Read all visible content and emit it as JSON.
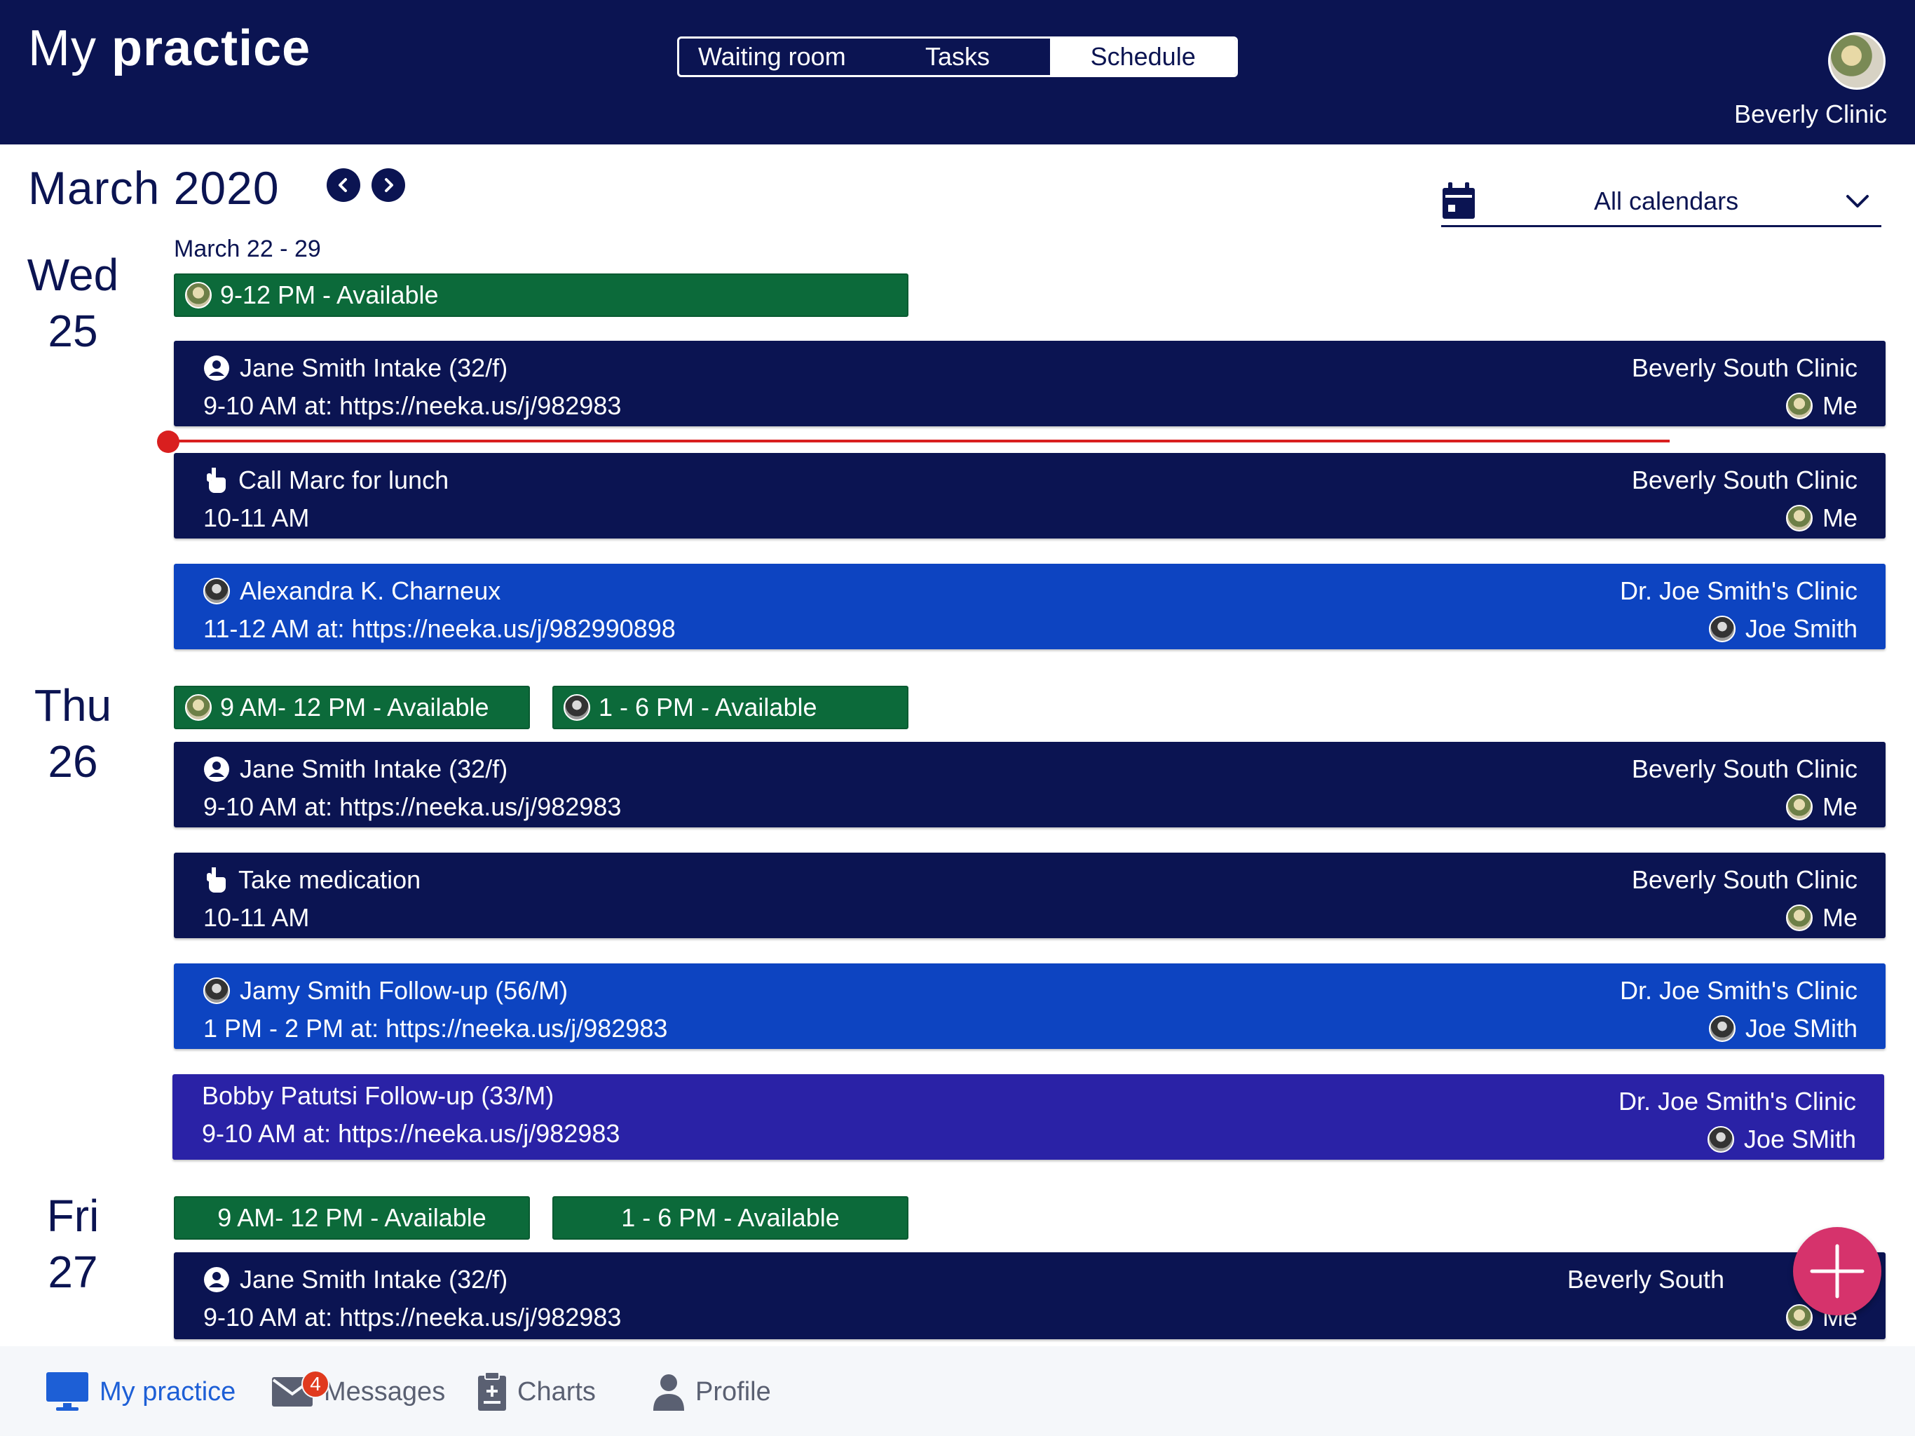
{
  "header": {
    "title_part1": "My",
    "title_part2": "practice",
    "tabs": [
      {
        "label": "Waiting room"
      },
      {
        "label": "Tasks"
      },
      {
        "label": "Schedule"
      }
    ],
    "active_tab": "Schedule",
    "clinic": "Beverly Clinic"
  },
  "toolbar": {
    "month": "March 2020",
    "prev_icon": "chevron-left-icon",
    "next_icon": "chevron-right-icon",
    "calendar_filter": "All calendars",
    "range": "March 22 - 29"
  },
  "days": [
    {
      "weekday": "Wed",
      "date": "25",
      "availability": [
        {
          "label": "9-12 PM - Available",
          "avatar": "me"
        }
      ],
      "events": [
        {
          "title": "Jane Smith Intake (32/f)",
          "subtitle": "9-10 AM at: https://neeka.us/j/982983",
          "clinic": "Beverly South Clinic",
          "who": "Me",
          "icon": "person-icon",
          "color": "#0b1452"
        },
        {
          "title": "Call Marc for lunch",
          "subtitle": "10-11 AM",
          "clinic": "Beverly South Clinic",
          "who": "Me",
          "icon": "hand-icon",
          "color": "#0b1452"
        },
        {
          "title": "Alexandra K. Charneux",
          "subtitle": "11-12 AM at: https://neeka.us/j/982990898",
          "clinic": "Dr. Joe Smith's Clinic",
          "who": "Joe Smith",
          "icon": "avatar-joe",
          "color": "#0d44c1"
        }
      ]
    },
    {
      "weekday": "Thu",
      "date": "26",
      "availability": [
        {
          "label": "9 AM- 12 PM - Available",
          "avatar": "me"
        },
        {
          "label": "1 - 6 PM - Available",
          "avatar": "joe"
        }
      ],
      "events": [
        {
          "title": "Jane Smith Intake (32/f)",
          "subtitle": "9-10 AM at: https://neeka.us/j/982983",
          "clinic": "Beverly South Clinic",
          "who": "Me",
          "icon": "person-icon",
          "color": "#0b1452"
        },
        {
          "title": "Take medication",
          "subtitle": "10-11 AM",
          "clinic": "Beverly South Clinic",
          "who": "Me",
          "icon": "hand-icon",
          "color": "#0b1452"
        },
        {
          "title": "Jamy Smith Follow-up (56/M)",
          "subtitle": "1 PM - 2 PM at: https://neeka.us/j/982983",
          "clinic": "Dr. Joe Smith's Clinic",
          "who": "Joe SMith",
          "icon": "avatar-joe",
          "color": "#0d44c1"
        },
        {
          "title": "Bobby Patutsi Follow-up (33/M)",
          "subtitle": "9-10 AM at: https://neeka.us/j/982983",
          "clinic": "Dr. Joe Smith's Clinic",
          "who": "Joe SMith",
          "icon": "",
          "color": "#2a22a6"
        }
      ]
    },
    {
      "weekday": "Fri",
      "date": "27",
      "availability": [
        {
          "label": "9 AM- 12 PM - Available"
        },
        {
          "label": "1 - 6 PM - Available"
        }
      ],
      "events": [
        {
          "title": "Jane Smith Intake (32/f)",
          "subtitle": "9-10 AM at: https://neeka.us/j/982983",
          "clinic": "Beverly South",
          "who": "Me",
          "icon": "person-icon",
          "color": "#0b1452"
        }
      ]
    }
  ],
  "fab": {
    "icon": "plus-icon"
  },
  "bottom_nav": {
    "items": [
      {
        "label": "My practice",
        "icon": "monitor-icon",
        "active": true
      },
      {
        "label": "Messages",
        "icon": "mail-icon",
        "badge": "4"
      },
      {
        "label": "Charts",
        "icon": "clipboard-icon"
      },
      {
        "label": "Profile",
        "icon": "person-icon"
      }
    ]
  }
}
